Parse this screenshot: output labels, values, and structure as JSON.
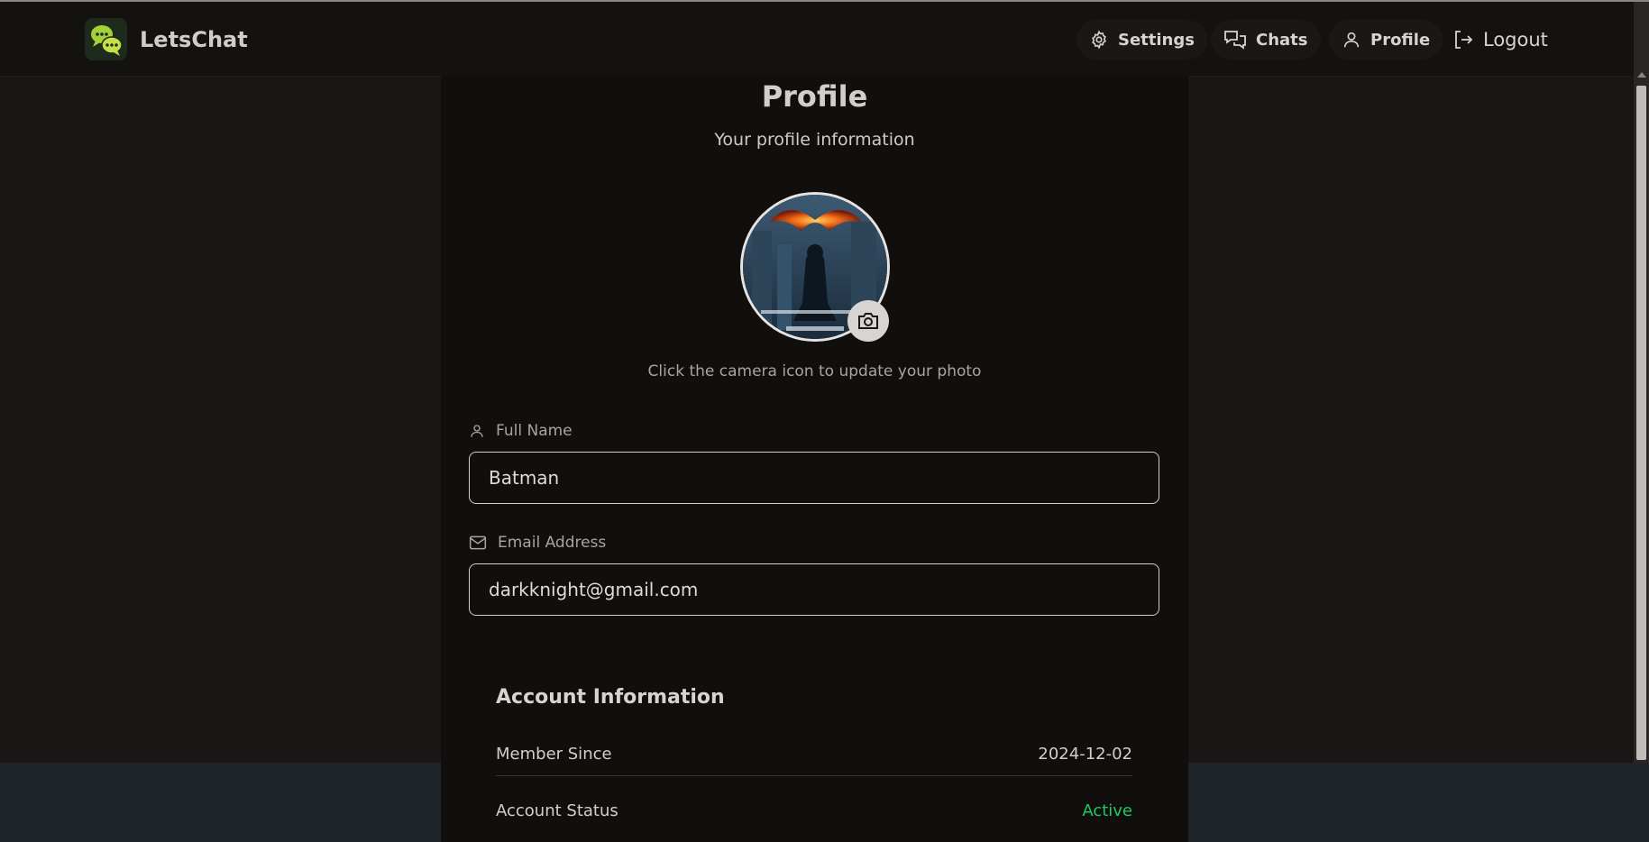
{
  "brand": {
    "name": "LetsChat",
    "logo_icon": "chat-bubbles-icon",
    "logo_color": "#a3d13a"
  },
  "nav": {
    "settings_label": "Settings",
    "chats_label": "Chats",
    "profile_label": "Profile",
    "logout_label": "Logout"
  },
  "profile": {
    "title": "Profile",
    "subtitle": "Your profile information",
    "avatar_alt": "batman-poster-avatar",
    "camera_hint": "Click the camera icon to update your photo"
  },
  "fields": {
    "full_name_label": "Full Name",
    "full_name_value": "Batman",
    "email_label": "Email Address",
    "email_value": "darkknight@gmail.com"
  },
  "account": {
    "title": "Account Information",
    "member_since_label": "Member Since",
    "member_since_value": "2024-12-02",
    "status_label": "Account Status",
    "status_value": "Active",
    "status_color": "#22c55e"
  }
}
